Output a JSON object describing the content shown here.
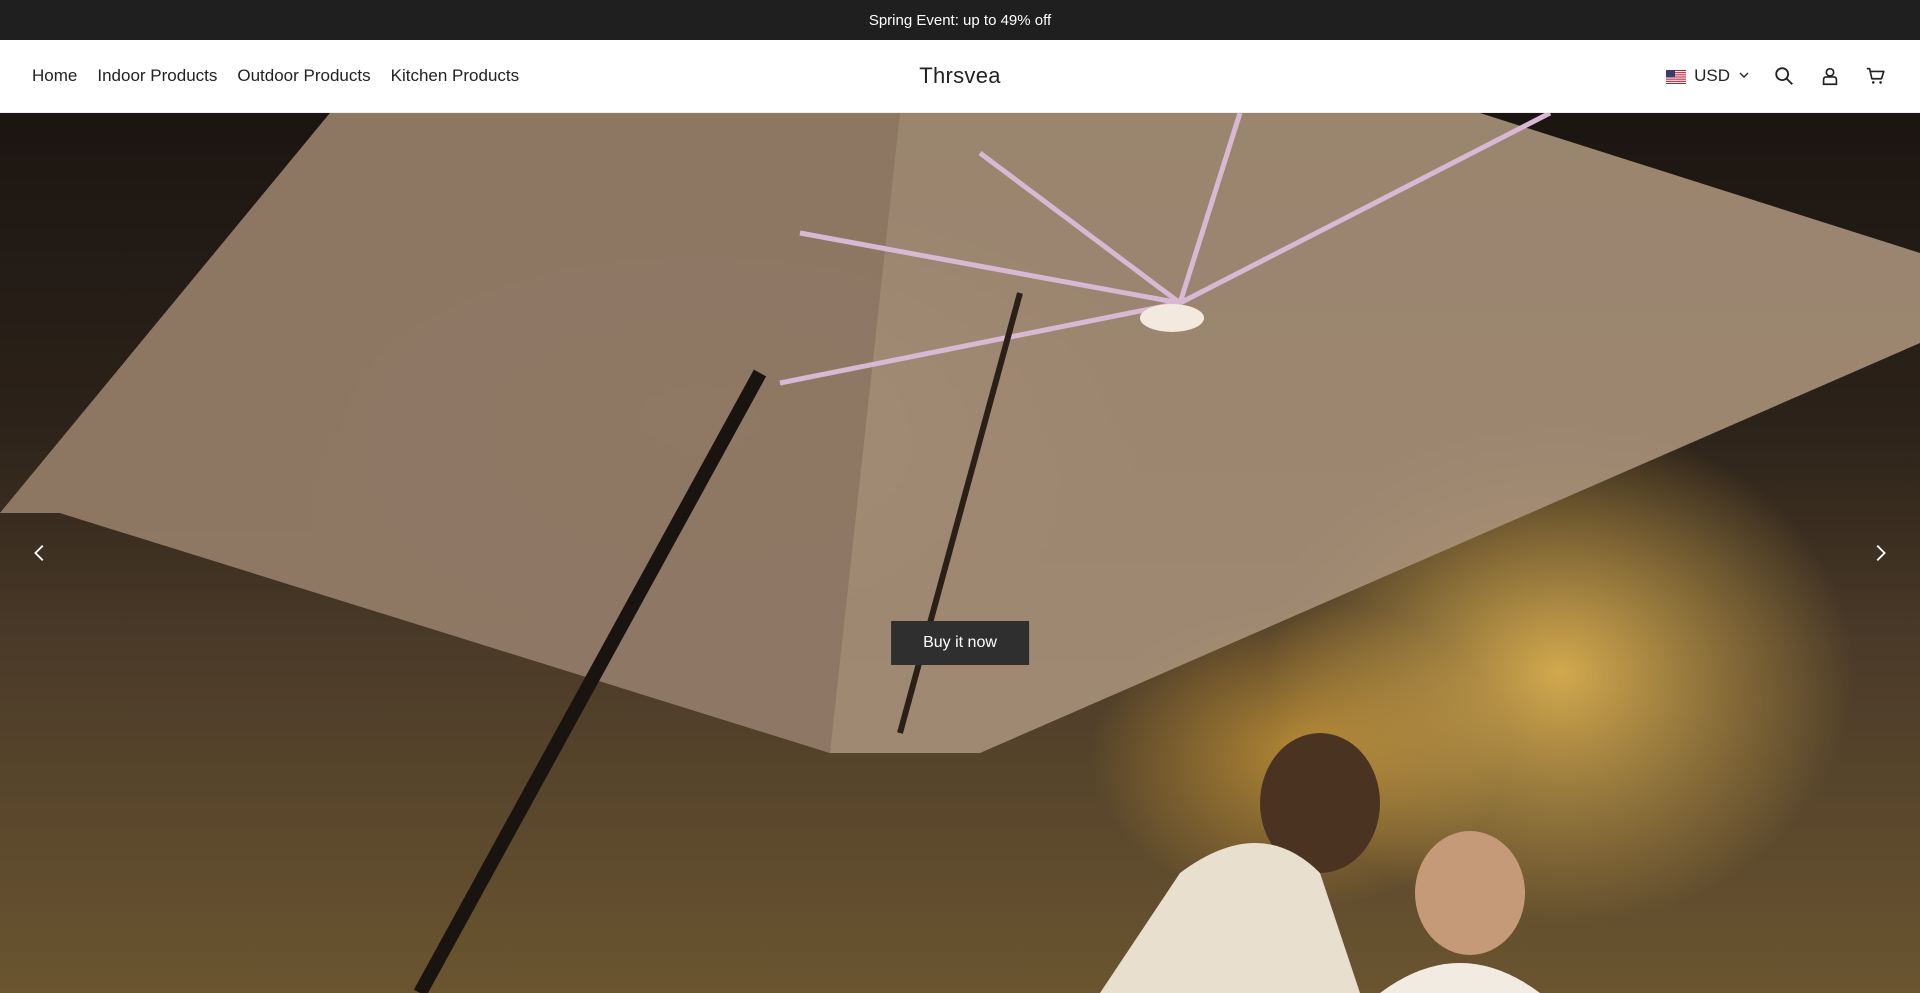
{
  "announcement": {
    "text": "Spring Event: up to 49% off"
  },
  "header": {
    "nav": [
      {
        "label": "Home"
      },
      {
        "label": "Indoor Products"
      },
      {
        "label": "Outdoor Products"
      },
      {
        "label": "Kitchen Products"
      }
    ],
    "logo": "Thrsvea",
    "currency": {
      "label": "USD",
      "flag": "us-flag-icon"
    },
    "icons": [
      "search-icon",
      "account-icon",
      "cart-icon"
    ]
  },
  "hero": {
    "cta_label": "Buy it now",
    "arrows": [
      "chevron-left-icon",
      "chevron-right-icon"
    ]
  },
  "colors": {
    "announcement_bg": "#1f1f1f",
    "header_bg": "#ffffff",
    "text": "#222222",
    "cta_bg": "#2f2f2f",
    "cta_text": "#ffffff"
  }
}
